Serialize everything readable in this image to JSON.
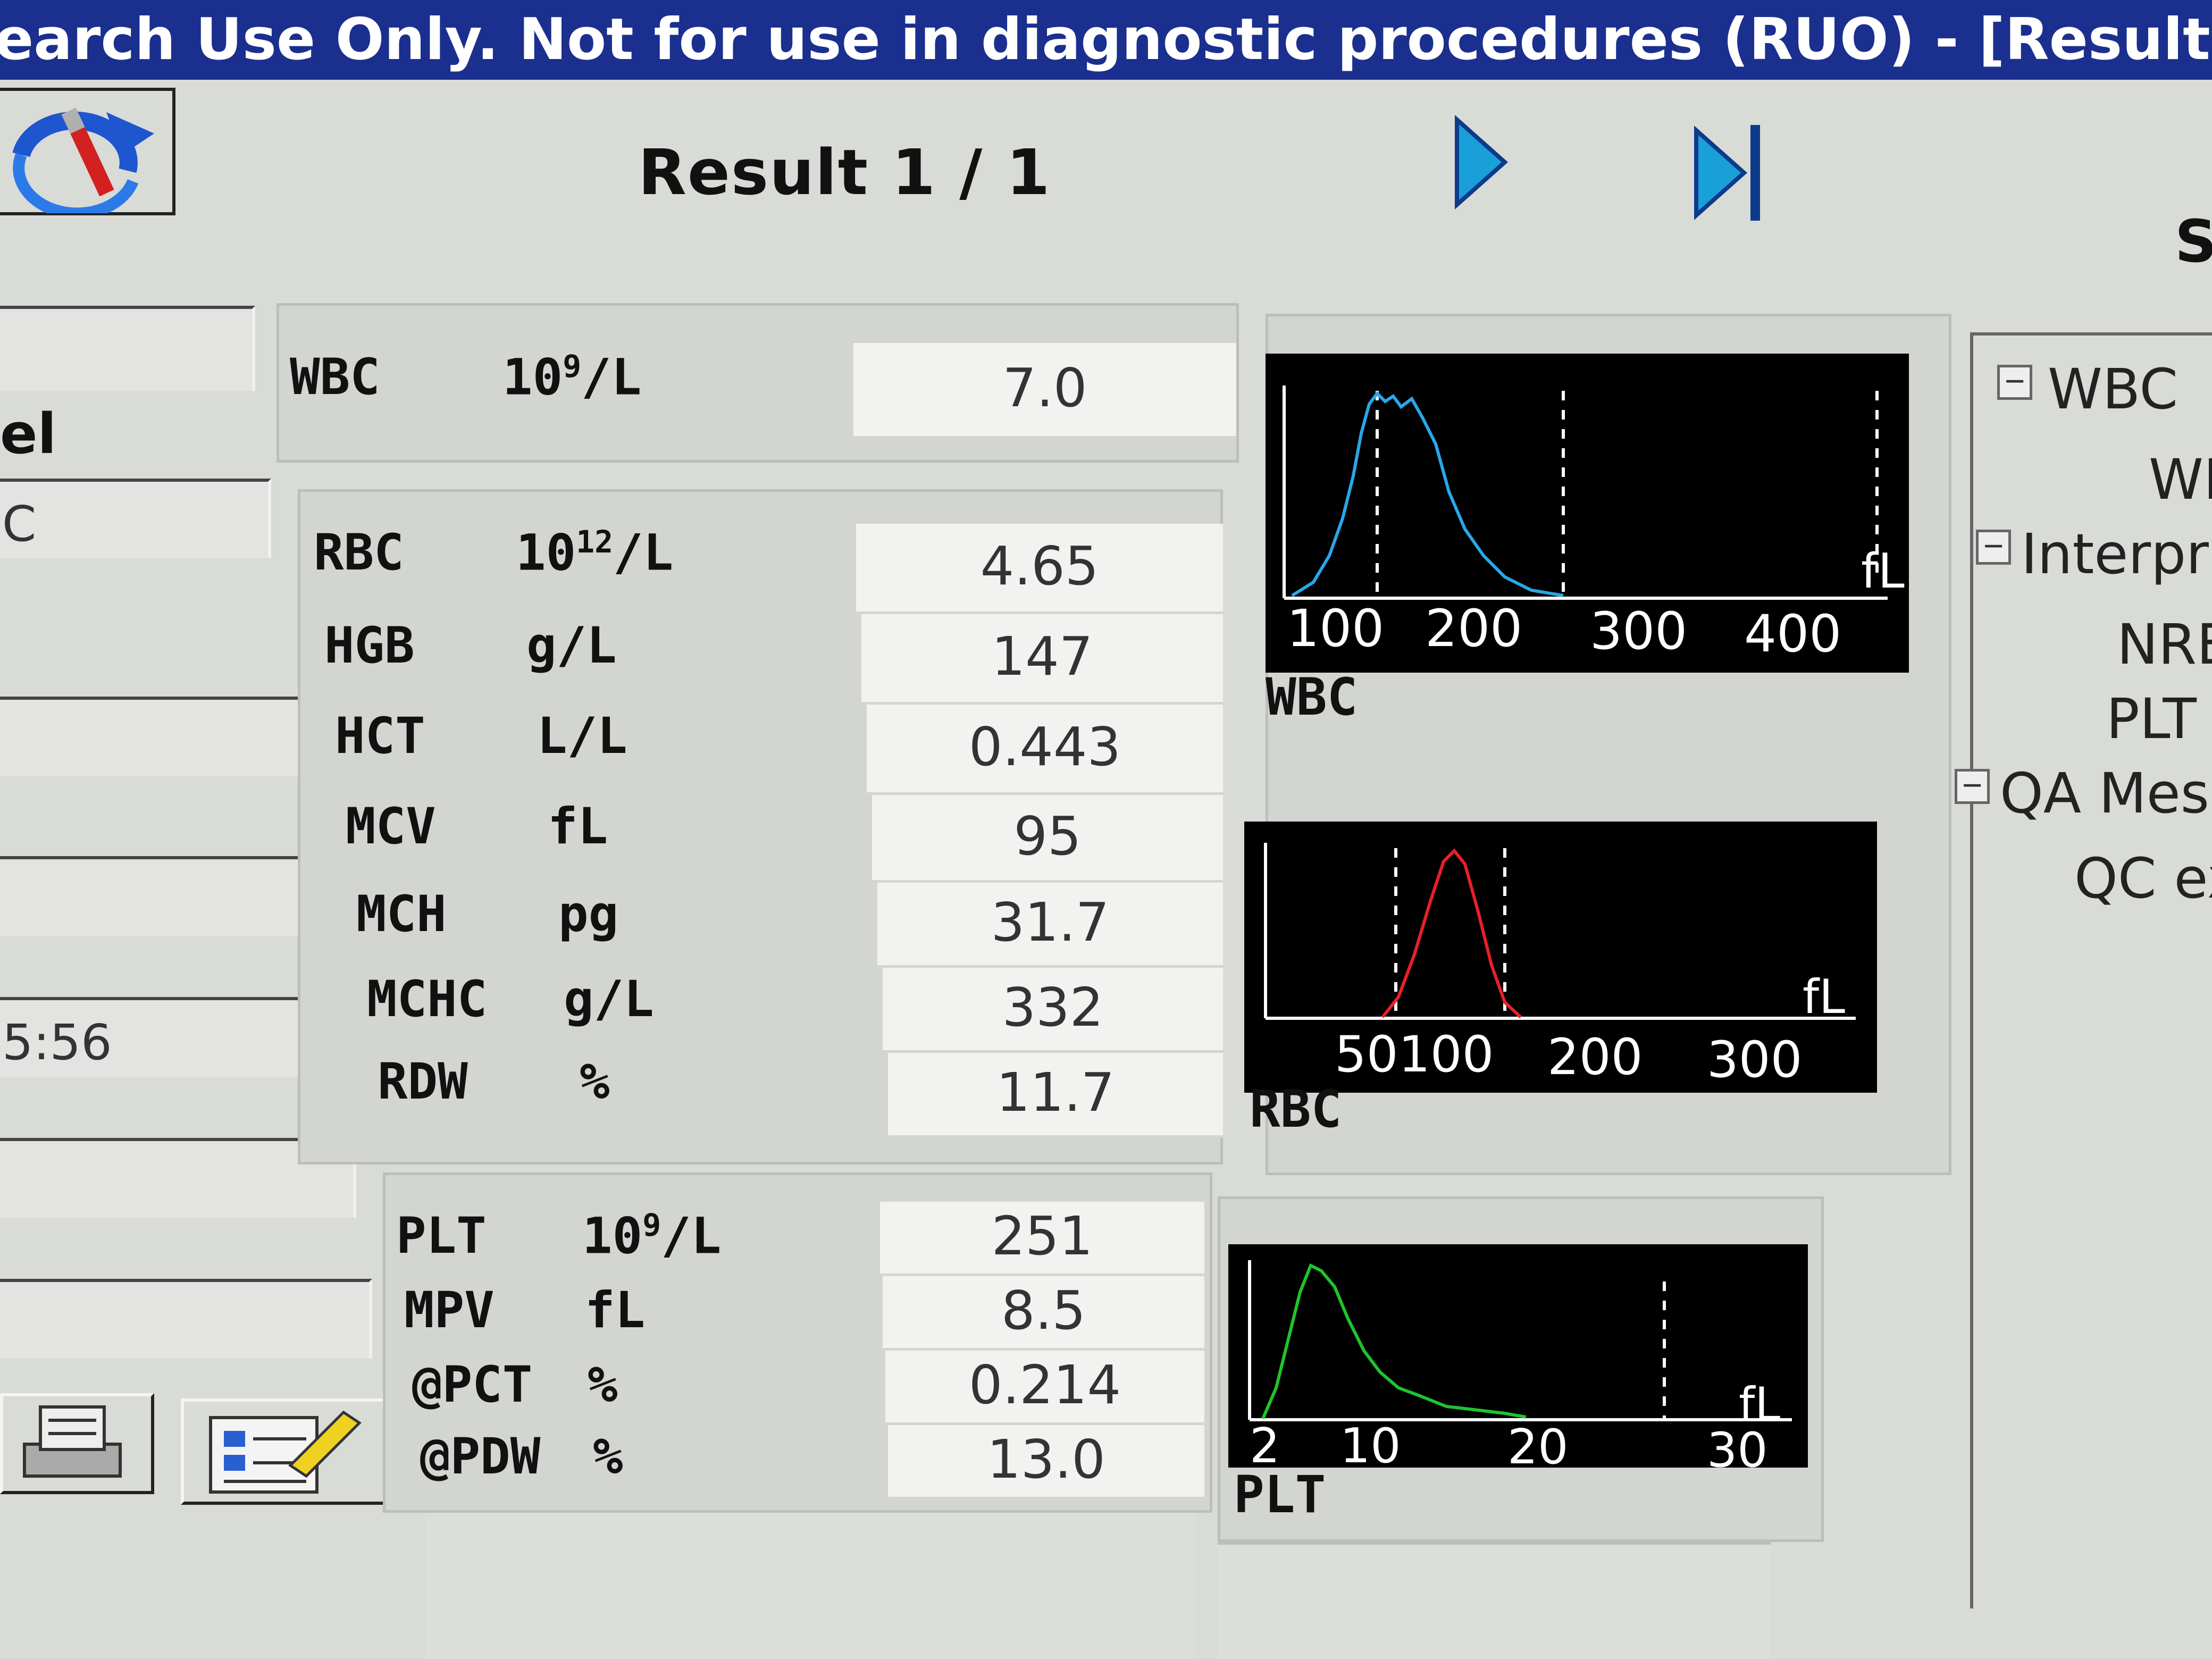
{
  "window": {
    "title": "earch Use Only. Not for use in diagnostic procedures (RUO) - [Results]"
  },
  "toolbar": {
    "result_label": "Result 1 / 1",
    "next_icon": "play-next-icon",
    "last_icon": "skip-to-last-icon",
    "refresh_icon": "refresh-edit-icon",
    "right_label": "S"
  },
  "left_panel": {
    "label_el": "el",
    "field_2": "C",
    "time_value": "5:56",
    "buttons": [
      "print-icon",
      "report-edit-icon"
    ]
  },
  "wbc_panel": {
    "rows": [
      {
        "name": "WBC",
        "unit_base": "10",
        "unit_exp": "9",
        "unit_tail": "/L",
        "value": "7.0"
      }
    ]
  },
  "rbc_panel": {
    "rows": [
      {
        "name": "RBC",
        "unit_base": "10",
        "unit_exp": "12",
        "unit_tail": "/L",
        "value": "4.65"
      },
      {
        "name": "HGB",
        "unit": "g/L",
        "value": "147"
      },
      {
        "name": "HCT",
        "unit": "L/L",
        "value": "0.443"
      },
      {
        "name": "MCV",
        "unit": "fL",
        "value": "95"
      },
      {
        "name": "MCH",
        "unit": "pg",
        "value": "31.7"
      },
      {
        "name": "MCHC",
        "unit": "g/L",
        "value": "332"
      },
      {
        "name": "RDW",
        "unit": "%",
        "value": "11.7"
      }
    ]
  },
  "plt_panel": {
    "rows": [
      {
        "name": "PLT",
        "unit_base": "10",
        "unit_exp": "9",
        "unit_tail": "/L",
        "value": "251"
      },
      {
        "name": "MPV",
        "unit": "fL",
        "value": "8.5"
      },
      {
        "name": "@PCT",
        "unit": "%",
        "value": "0.214"
      },
      {
        "name": "@PDW",
        "unit": "%",
        "value": "13.0"
      }
    ]
  },
  "histograms": {
    "wbc": {
      "title": "WBC",
      "unit": "fL",
      "ticks": [
        "100",
        "200",
        "300",
        "400"
      ],
      "color": "#2aa7e8"
    },
    "rbc": {
      "title": "RBC",
      "unit": "fL",
      "ticks": [
        "50",
        "100",
        "200",
        "300"
      ],
      "color": "#e8202a"
    },
    "plt": {
      "title": "PLT",
      "unit": "fL",
      "ticks": [
        "2",
        "10",
        "20",
        "30"
      ],
      "color": "#1fc42a"
    }
  },
  "tree": {
    "items": [
      {
        "label": "WBC",
        "expander": "⊟"
      },
      {
        "label": "WI"
      },
      {
        "label": "Interpr",
        "expander": "⊟"
      },
      {
        "label": "NRE"
      },
      {
        "label": "PLT"
      },
      {
        "label": "QA Mess",
        "expander": "⊟"
      },
      {
        "label": "QC ex"
      }
    ]
  },
  "colors": {
    "titlebar": "#1b2f8e",
    "window_bg": "#d9dbd7",
    "value_bg": "#f2f2f0",
    "histogram_bg": "#000000"
  }
}
